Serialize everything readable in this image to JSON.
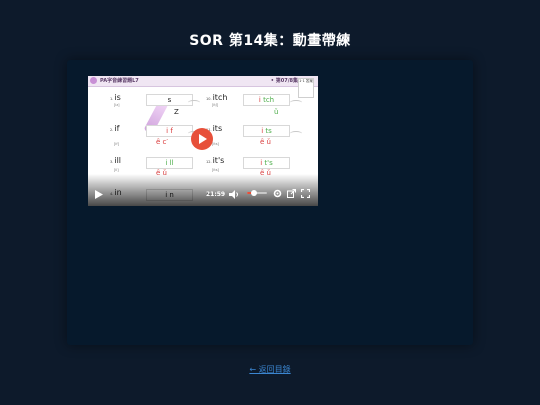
{
  "page": {
    "title": "SOR 第14集：動畫帶練"
  },
  "video": {
    "header_left": "PA字音練習題L7",
    "header_right": "• 第07/8集",
    "corner_badge": "1·1 答案",
    "rows": [
      {
        "num": "1.",
        "word": "is",
        "phon": "[iz]",
        "box_left": "s",
        "hl_left": "Z",
        "hl_left_color": "#222222",
        "num2": "10.",
        "word2": "itch",
        "phon2": "[itʃ]",
        "box2_a": "i",
        "box2_b": "tch",
        "hl2": "ǔ"
      },
      {
        "num": "2.",
        "word": "if",
        "phon": "[if]",
        "box_left": "i f",
        "hl_left": "ȇ c′",
        "hl_left_color": "#d93b3b",
        "num2": "11.",
        "word2": "its",
        "phon2": "[its]",
        "box2_a": "i",
        "box2_b": "ts",
        "hl2": "ȇ ǔ"
      },
      {
        "num": "3.",
        "word": "ill",
        "phon": "[il]",
        "box_left": "i ll",
        "hl_left": "ȇ ǔ",
        "hl_left_color": "#d93b3b",
        "num2": "12.",
        "word2": "it's",
        "phon2": "[its]",
        "box2_a": "i",
        "box2_b": "t's",
        "hl2": "ȇ ǔ"
      },
      {
        "num": "4.",
        "word": "in",
        "phon": "",
        "box_left": "i n",
        "hl_left": "",
        "hl_left_color": "#222222",
        "num2": "13.",
        "word2": "",
        "phon2": "",
        "box2_a": "",
        "box2_b": "",
        "hl2": ""
      }
    ],
    "time": "21:59",
    "progress": 0.35
  },
  "footer": {
    "back_link": "← 返回目錄"
  },
  "colors": {
    "background": "#0d1a2b",
    "stage": "#06192c",
    "accent": "#e7503a",
    "link": "#3b86d1"
  },
  "icons": [
    "play-icon",
    "volume-icon",
    "settings-icon",
    "popout-icon",
    "fullscreen-icon",
    "play-overlay-icon"
  ]
}
